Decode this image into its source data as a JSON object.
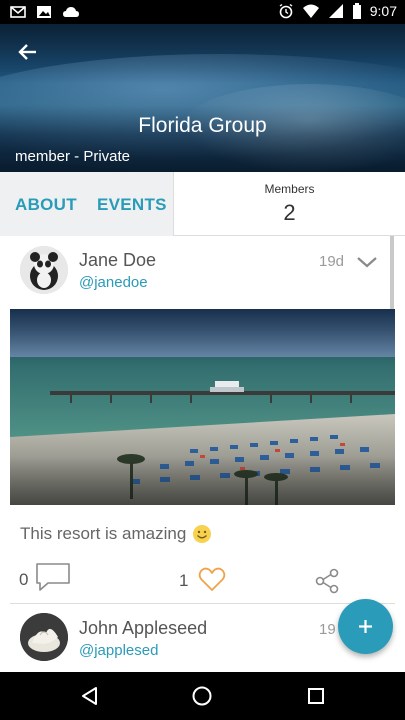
{
  "status_bar": {
    "time": "9:07",
    "icons_left": [
      "mail-icon",
      "image-icon",
      "cloud-icon"
    ],
    "icons_right": [
      "alarm-icon",
      "wifi-icon",
      "signal-icon",
      "battery-icon"
    ]
  },
  "header": {
    "title": "Florida Group",
    "subtitle": "member - Private"
  },
  "tabs": {
    "about": "ABOUT",
    "events": "EVENTS",
    "members_label": "Members",
    "members_count": "2"
  },
  "posts": [
    {
      "author": "Jane Doe",
      "handle": "@janedoe",
      "age": "19d",
      "text": "This resort is amazing",
      "comments": "0",
      "likes": "1"
    },
    {
      "author": "John Appleseed",
      "handle": "@japplesed",
      "age": "19"
    }
  ],
  "colors": {
    "accent": "#2a9bb8",
    "like": "#f0a24a",
    "tab_bg": "#eef0f1"
  }
}
